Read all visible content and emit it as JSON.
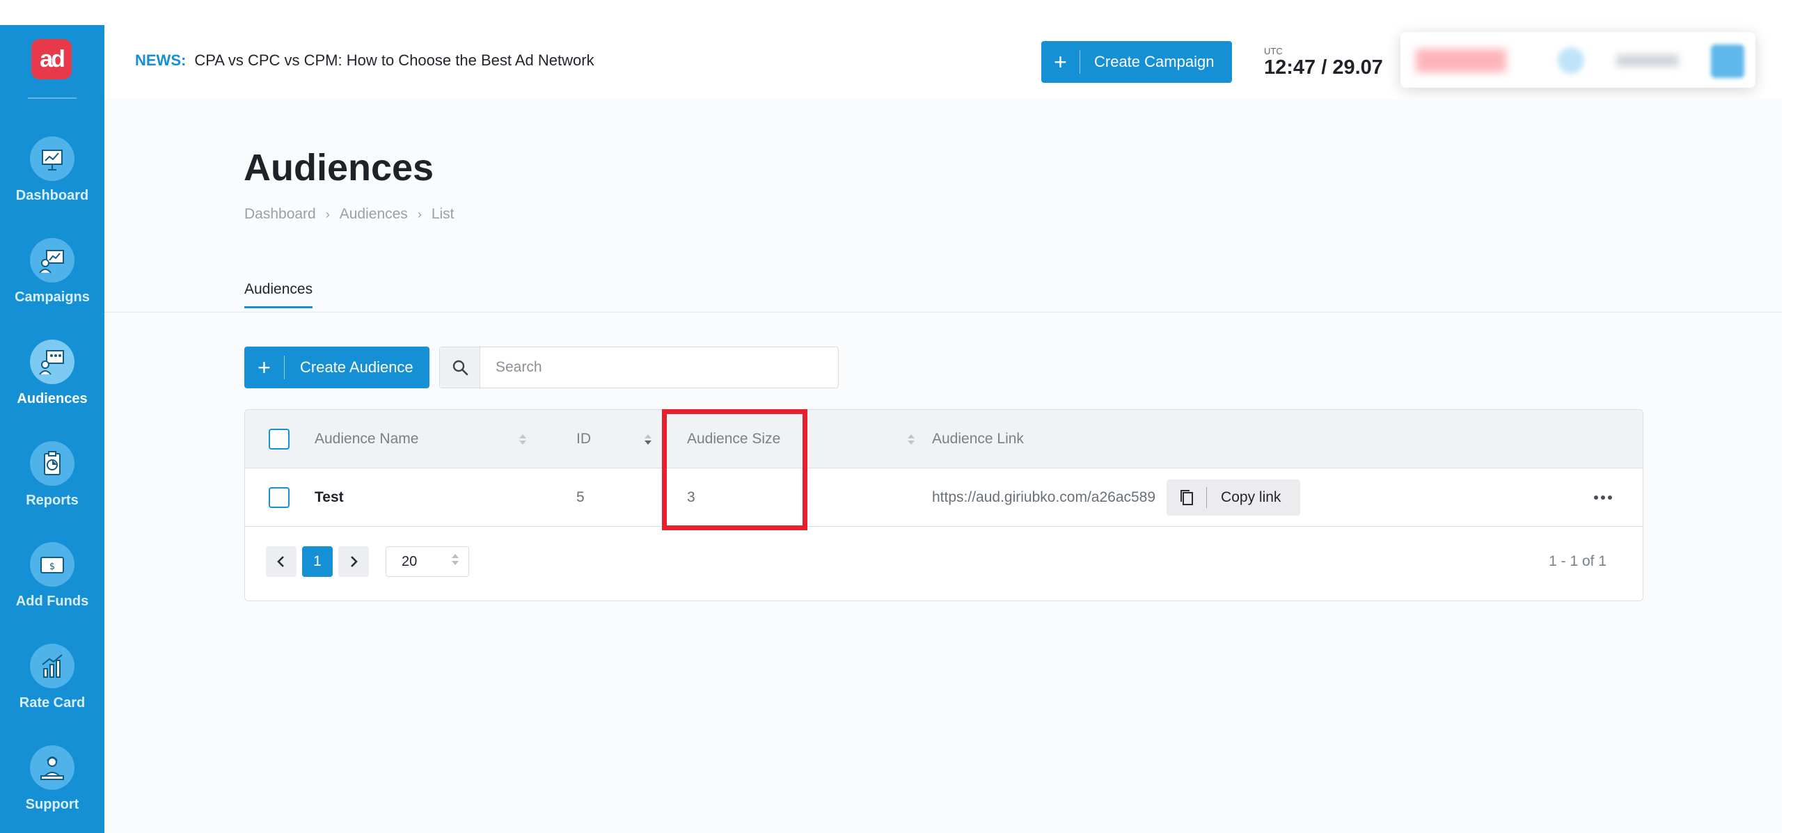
{
  "sidebar": {
    "logo_text": "ad",
    "items": [
      {
        "label": "Dashboard",
        "icon": "dashboard-icon",
        "active": false
      },
      {
        "label": "Campaigns",
        "icon": "campaigns-icon",
        "active": false
      },
      {
        "label": "Audiences",
        "icon": "audiences-icon",
        "active": true
      },
      {
        "label": "Reports",
        "icon": "reports-icon",
        "active": false
      },
      {
        "label": "Add Funds",
        "icon": "add-funds-icon",
        "active": false
      },
      {
        "label": "Rate Card",
        "icon": "rate-card-icon",
        "active": false
      },
      {
        "label": "Support",
        "icon": "support-icon",
        "active": false
      }
    ]
  },
  "topbar": {
    "news_tag": "NEWS:",
    "news_text": "CPA vs CPC vs CPM: How to Choose the Best Ad Network",
    "create_campaign_label": "Create Campaign",
    "utc_label": "UTC",
    "time": "12:47 / 29.07"
  },
  "page": {
    "title": "Audiences",
    "breadcrumb": [
      "Dashboard",
      "Audiences",
      "List"
    ],
    "tab": "Audiences"
  },
  "toolbar": {
    "create_label": "Create Audience",
    "search_placeholder": "Search"
  },
  "table": {
    "columns": [
      "Audience Name",
      "ID",
      "Audience Size",
      "Audience Link"
    ],
    "rows": [
      {
        "name": "Test",
        "id": "5",
        "size": "3",
        "link": "https://aud.giriubko.com/a26ac589",
        "copy_label": "Copy link"
      }
    ]
  },
  "pagination": {
    "current_page": "1",
    "page_size": "20",
    "range": "1 - 1 of 1"
  },
  "colors": {
    "brand": "#1590d5",
    "logo": "#e8394a",
    "highlight": "#e8202e"
  }
}
